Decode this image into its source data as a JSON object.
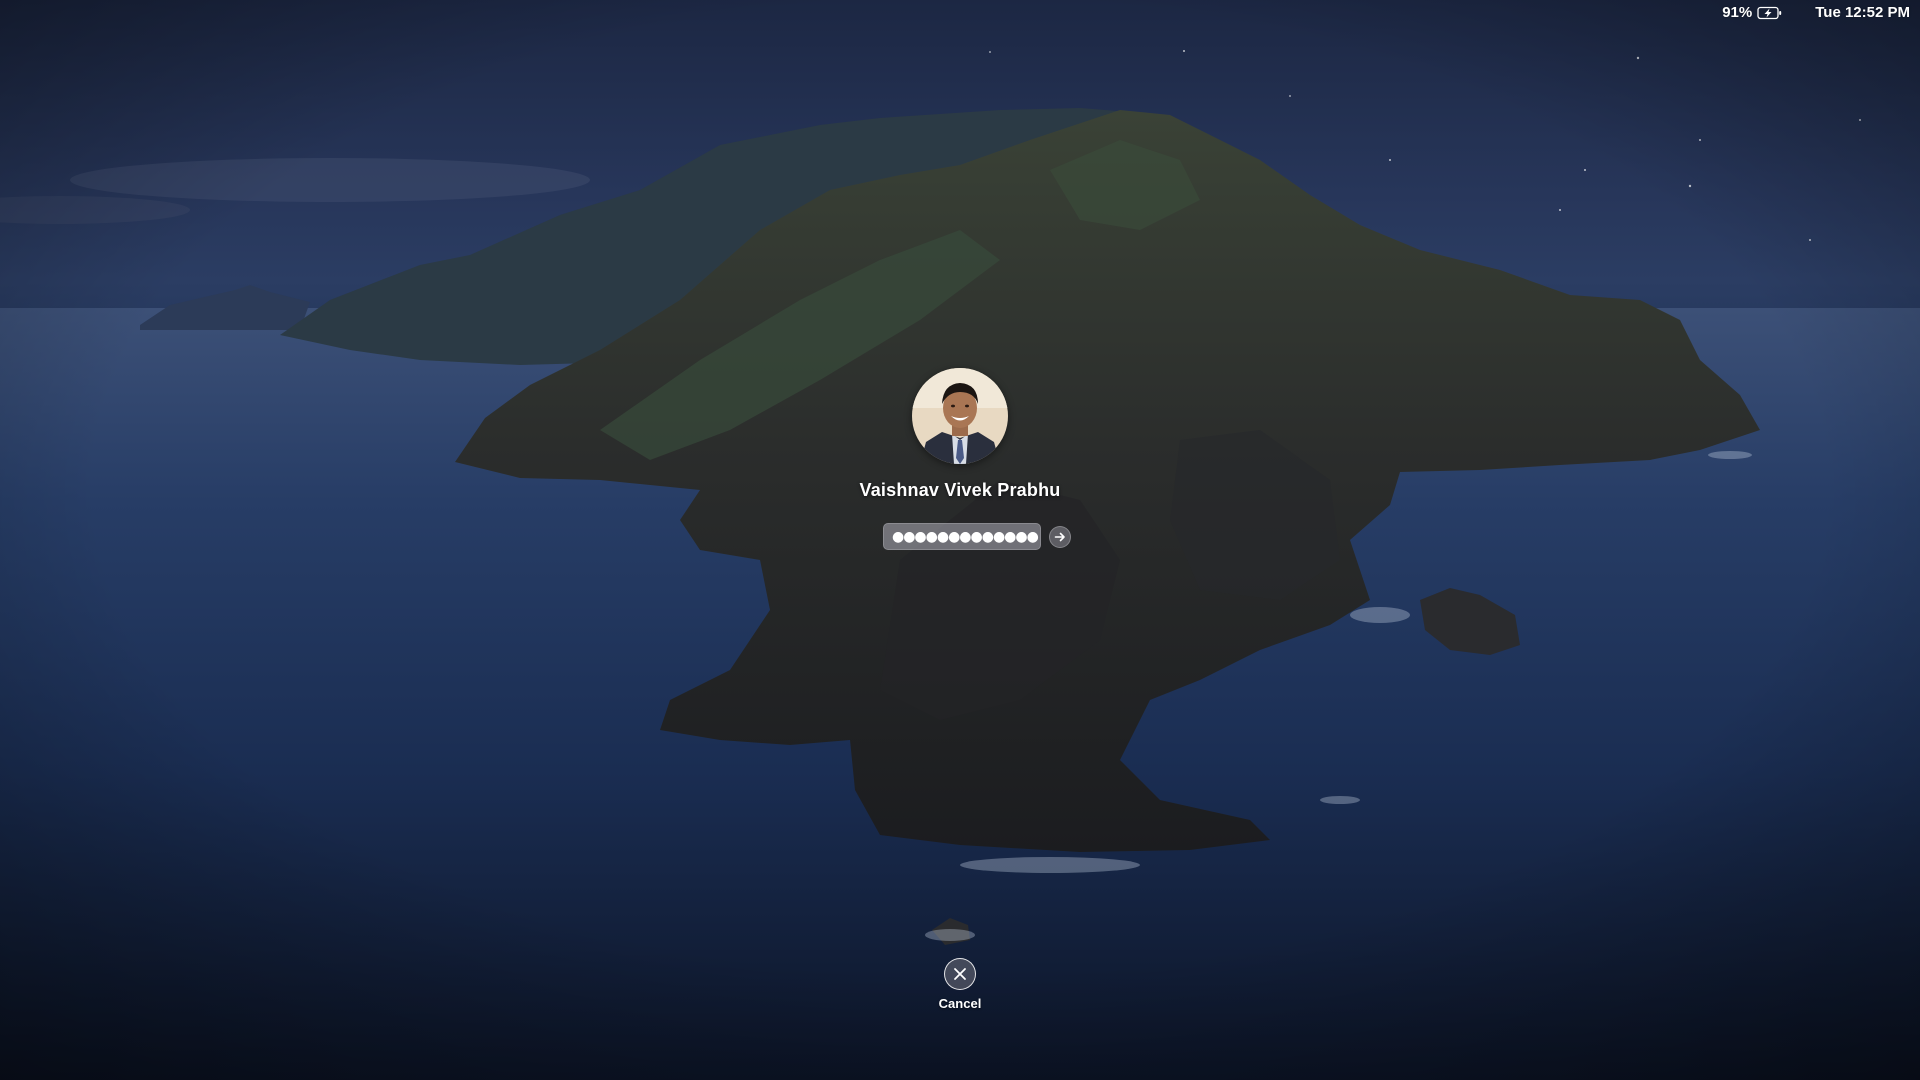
{
  "status_bar": {
    "battery_percent": "91%",
    "battery_icon": "battery-charging-icon",
    "clock": "Tue 12:52 PM"
  },
  "login": {
    "user_name": "Vaishnav Vivek Prabhu",
    "password_masked": "●●●●●●●●●●●●●",
    "submit_icon": "arrow-right-icon"
  },
  "cancel": {
    "label": "Cancel",
    "icon": "close-icon"
  },
  "colors": {
    "text": "#ffffff",
    "field_bg": "#a9a9b4",
    "sky": "#23345a",
    "sea": "#142340"
  }
}
